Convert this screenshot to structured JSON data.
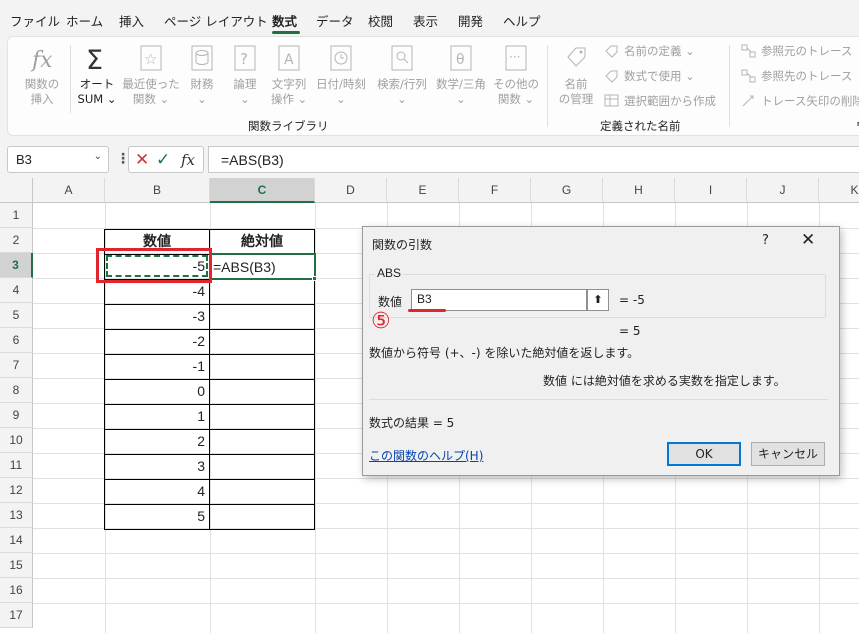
{
  "menu": {
    "tabs": [
      "ファイル",
      "ホーム",
      "挿入",
      "ページ レイアウト",
      "数式",
      "データ",
      "校閲",
      "表示",
      "開発",
      "ヘルプ"
    ],
    "active_tab": "数式"
  },
  "ribbon": {
    "buttons": [
      {
        "label1": "関数の",
        "label2": "挿入",
        "icon": "function-insert-icon"
      },
      {
        "label1": "オート",
        "label2": "SUM ⌄",
        "icon": "sigma-icon"
      },
      {
        "label1": "最近使った",
        "label2": "関数 ⌄",
        "icon": "star-icon"
      },
      {
        "label1": "財務",
        "label2": "⌄",
        "icon": "database-icon"
      },
      {
        "label1": "論理",
        "label2": "⌄",
        "icon": "question-icon"
      },
      {
        "label1": "文字列",
        "label2": "操作 ⌄",
        "icon": "text-icon"
      },
      {
        "label1": "日付/時刻",
        "label2": "⌄",
        "icon": "clock-icon"
      },
      {
        "label1": "検索/行列",
        "label2": "⌄",
        "icon": "lookup-icon"
      },
      {
        "label1": "数学/三角",
        "label2": "⌄",
        "icon": "theta-icon"
      },
      {
        "label1": "その他の",
        "label2": "関数 ⌄",
        "icon": "more-icon"
      }
    ],
    "group1_label": "関数ライブラリ",
    "name_manager": {
      "label1": "名前",
      "label2": "の管理"
    },
    "names_small": [
      "名前の定義 ⌄",
      "数式で使用 ⌄",
      "選択範囲から作成"
    ],
    "group2_label": "定義された名前",
    "audit_small": [
      "参照元のトレース",
      "参照先のトレース",
      "トレース矢印の削除 ⌄"
    ],
    "group3_label": "ワ"
  },
  "formula_bar": {
    "name_box": "B3",
    "formula": "=ABS(B3)"
  },
  "grid": {
    "columns": [
      "A",
      "B",
      "C",
      "D",
      "E",
      "F",
      "G",
      "H",
      "I",
      "J",
      "K"
    ],
    "rows": [
      "1",
      "2",
      "3",
      "4",
      "5",
      "6",
      "7",
      "8",
      "9",
      "10",
      "11",
      "12",
      "13",
      "14",
      "15",
      "16",
      "17"
    ],
    "header_b": "数値",
    "header_c": "絶対値",
    "values_b": [
      "-5",
      "-4",
      "-3",
      "-2",
      "-1",
      "0",
      "1",
      "2",
      "3",
      "4",
      "5"
    ],
    "c3": "=ABS(B3)"
  },
  "dialog": {
    "title": "関数の引数",
    "help_q": "?",
    "close": "✕",
    "function_name": "ABS",
    "arg_label": "数値",
    "arg_value": "B3",
    "arg_result": "=  -5",
    "result_eq": "=  5",
    "description": "数値から符号 (+、-) を除いた絶対値を返します。",
    "arg_desc": "数値  には絶対値を求める実数を指定します。",
    "formula_result": "数式の結果 =  5",
    "help_link": "この関数のヘルプ(H)",
    "ok": "OK",
    "cancel": "キャンセル"
  },
  "annotation": {
    "marker": "⑤",
    "color": "#e0262c"
  },
  "colors": {
    "accent": "#1e7145",
    "highlight_box": "#e0262c"
  }
}
